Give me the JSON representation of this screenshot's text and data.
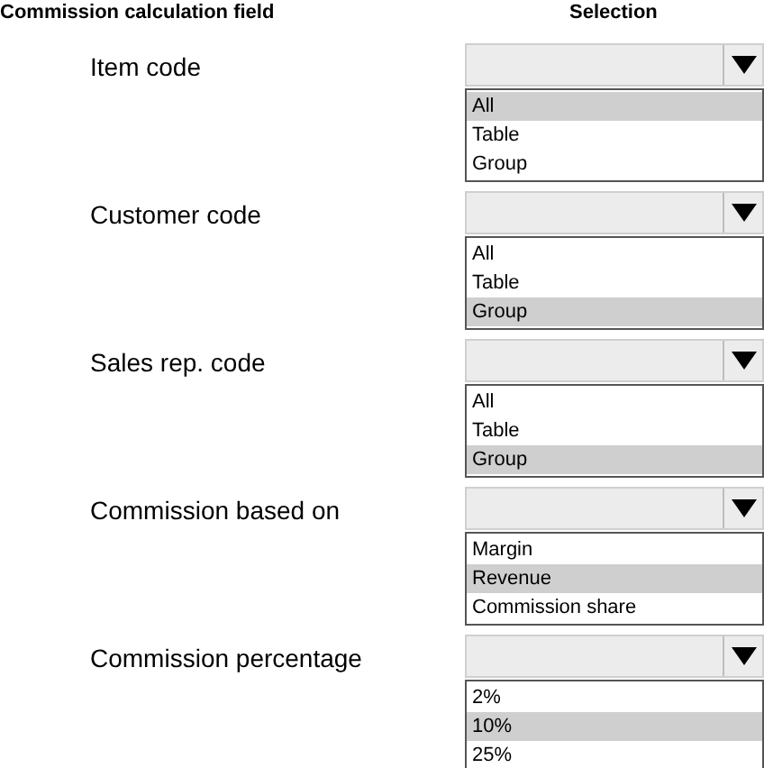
{
  "headers": {
    "field": "Commission calculation field",
    "selection": "Selection"
  },
  "rows": [
    {
      "label": "Item code",
      "options": [
        {
          "text": "All",
          "selected": true
        },
        {
          "text": "Table",
          "selected": false
        },
        {
          "text": "Group",
          "selected": false
        }
      ]
    },
    {
      "label": "Customer code",
      "options": [
        {
          "text": "All",
          "selected": false
        },
        {
          "text": "Table",
          "selected": false
        },
        {
          "text": "Group",
          "selected": true
        }
      ]
    },
    {
      "label": "Sales rep. code",
      "options": [
        {
          "text": "All",
          "selected": false
        },
        {
          "text": "Table",
          "selected": false
        },
        {
          "text": "Group",
          "selected": true
        }
      ]
    },
    {
      "label": "Commission based on",
      "options": [
        {
          "text": "Margin",
          "selected": false
        },
        {
          "text": "Revenue",
          "selected": true
        },
        {
          "text": "Commission share",
          "selected": false
        }
      ]
    },
    {
      "label": "Commission percentage",
      "options": [
        {
          "text": "2%",
          "selected": false
        },
        {
          "text": "10%",
          "selected": true
        },
        {
          "text": "25%",
          "selected": false
        }
      ]
    }
  ]
}
